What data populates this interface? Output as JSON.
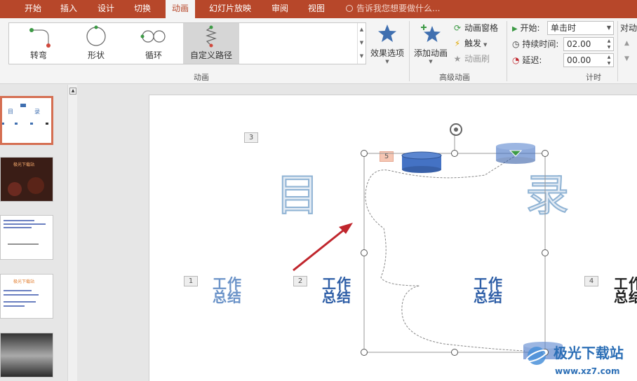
{
  "tabs": [
    "开始",
    "插入",
    "设计",
    "切换",
    "动画",
    "幻灯片放映",
    "审阅",
    "视图"
  ],
  "active_tab": "动画",
  "tell_me": "告诉我您想要做什么...",
  "gallery": {
    "items": [
      {
        "label": "转弯",
        "icon": "path-turn-icon"
      },
      {
        "label": "形状",
        "icon": "path-shape-circle-icon"
      },
      {
        "label": "循环",
        "icon": "path-loop-icon"
      },
      {
        "label": "自定义路径",
        "icon": "custom-path-icon",
        "selected": true
      }
    ]
  },
  "effect_options": "效果选项",
  "group_animation": "动画",
  "add_animation": "添加动画",
  "animation_pane": "动画窗格",
  "trigger": "触发",
  "animation_painter": "动画刷",
  "group_advanced": "高级动画",
  "timing": {
    "start_label": "开始:",
    "start_value": "单击时",
    "duration_label": "持续时间:",
    "duration_value": "02.00",
    "delay_label": "延迟:",
    "delay_value": "00.00",
    "reorder_label": "对动",
    "group_label": "计时"
  },
  "slide": {
    "title_left": "目",
    "title_right": "录",
    "item_text": "工作\n总结",
    "tags": [
      "3",
      "5",
      "1",
      "2",
      "4"
    ]
  },
  "thumbs": {
    "t1_left": "目",
    "t1_right": "录",
    "t2_title": "极光下载站",
    "t4_title": "极光下载站"
  },
  "watermark": {
    "main": "极光下载站",
    "sub": "www.xz7.com"
  },
  "colors": {
    "accent": "#b7472a",
    "title_blue": "#3f6fb0",
    "arrow_red": "#c0262d"
  }
}
